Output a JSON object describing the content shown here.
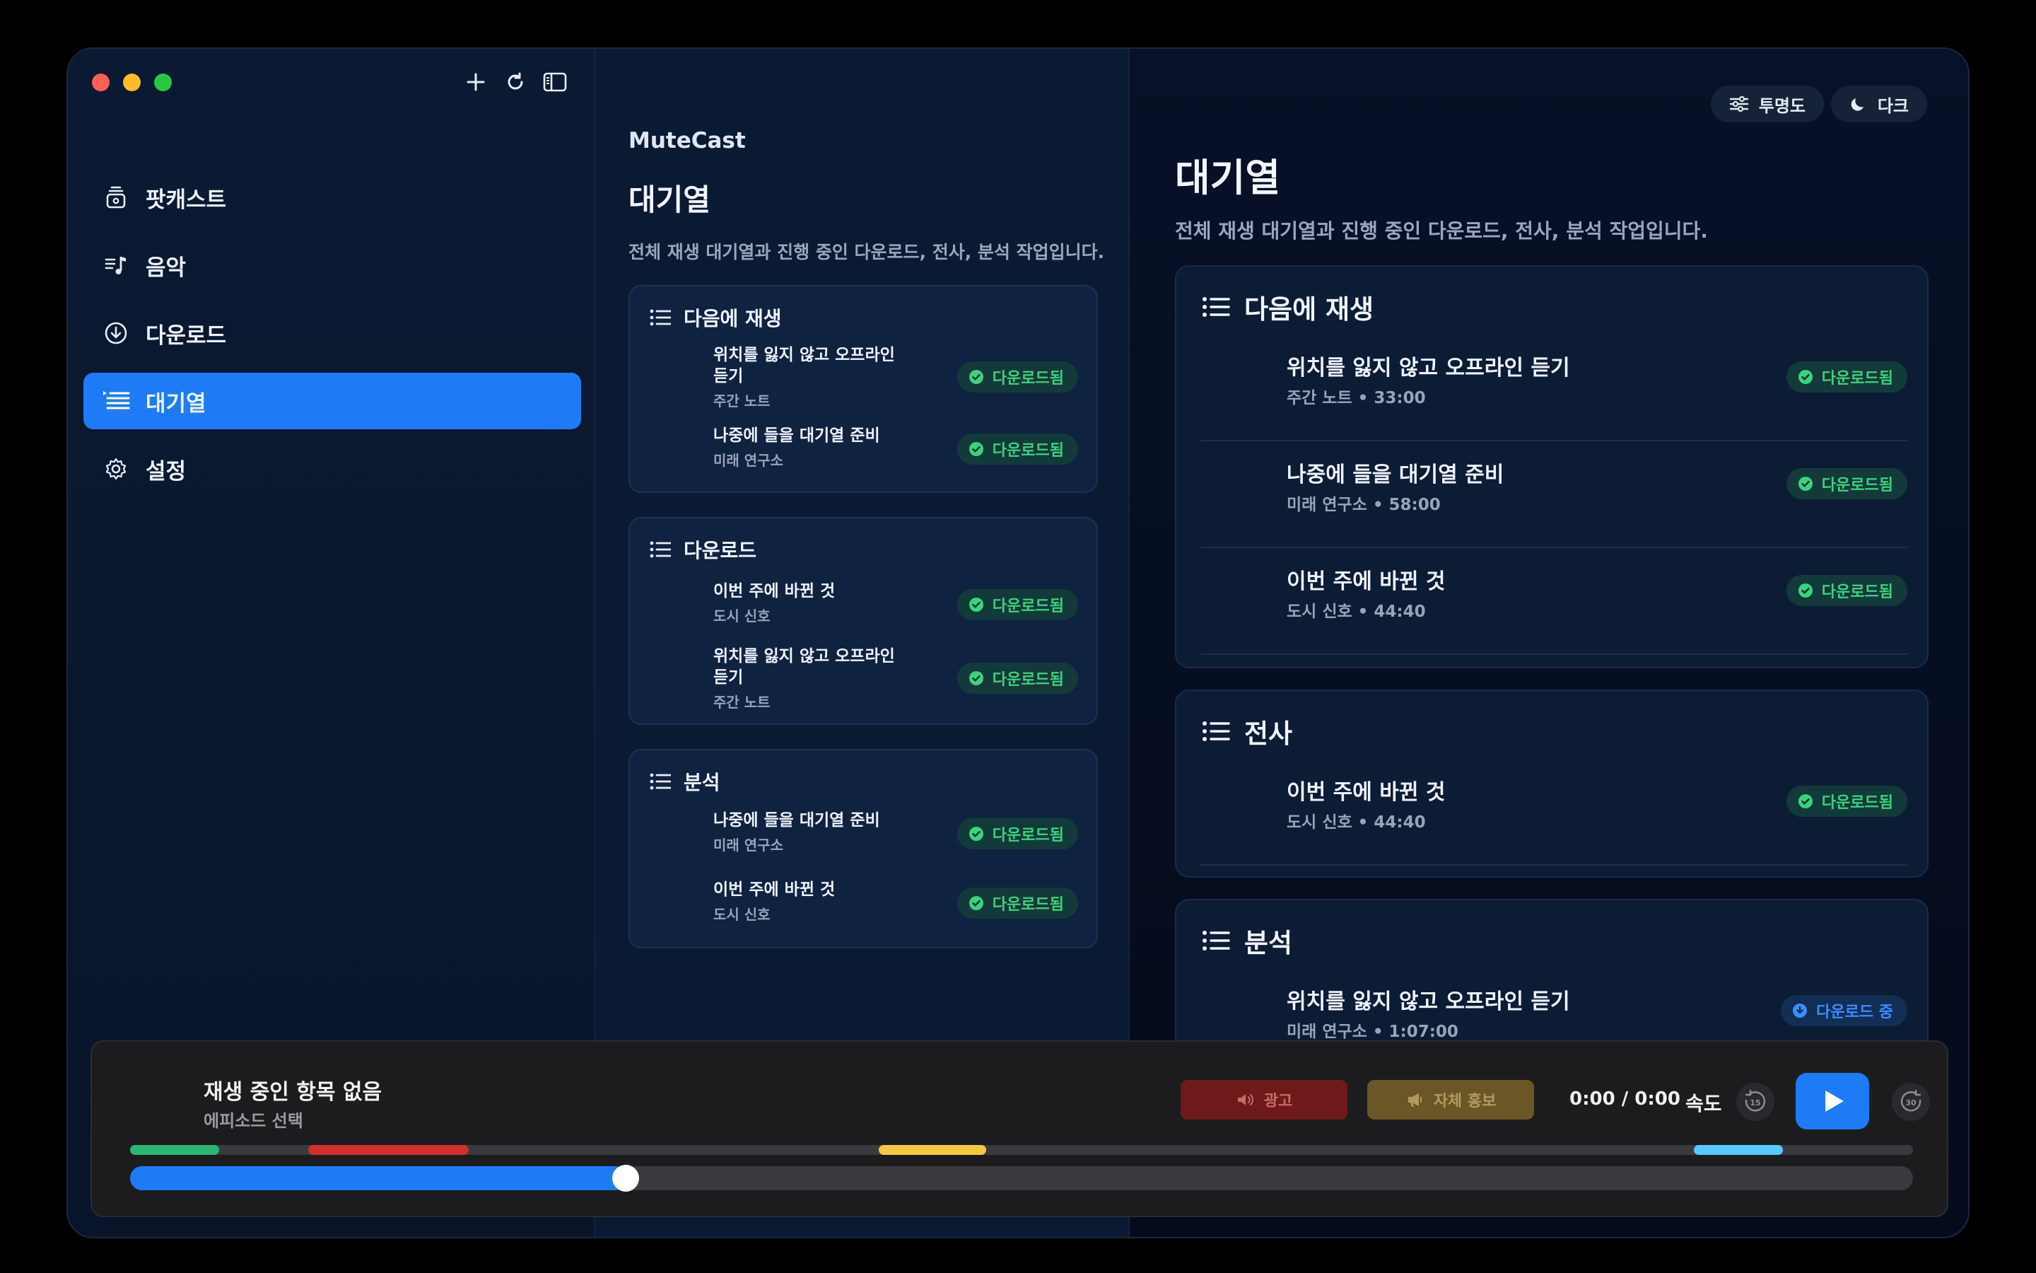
{
  "colors": {
    "accent": "#1e7bf5",
    "downloaded": "#3ed27b",
    "downloading": "#3d8cff"
  },
  "sidebar": {
    "items": [
      {
        "label": "팟캐스트",
        "icon": "podcast-icon"
      },
      {
        "label": "음악",
        "icon": "music-icon"
      },
      {
        "label": "다운로드",
        "icon": "download-icon"
      },
      {
        "label": "대기열",
        "icon": "queue-icon",
        "active": true
      },
      {
        "label": "설정",
        "icon": "gear-icon"
      }
    ]
  },
  "middle": {
    "app_name": "MuteCast",
    "title": "대기열",
    "description": "전체 재생 대기열과 진행 중인 다운로드, 전사, 분석 작업입니다.",
    "sections": [
      {
        "title": "다음에 재생",
        "items": [
          {
            "title": "위치를 잃지 않고 오프라인 듣기",
            "subtitle": "주간 노트",
            "status": "다운로드됨"
          },
          {
            "title": "나중에 들을 대기열 준비",
            "subtitle": "미래 연구소",
            "status": "다운로드됨"
          }
        ]
      },
      {
        "title": "다운로드",
        "items": [
          {
            "title": "이번 주에 바뀐 것",
            "subtitle": "도시 신호",
            "status": "다운로드됨"
          },
          {
            "title": "위치를 잃지 않고 오프라인 듣기",
            "subtitle": "주간 노트",
            "status": "다운로드됨"
          }
        ]
      },
      {
        "title": "분석",
        "items": [
          {
            "title": "나중에 들을 대기열 준비",
            "subtitle": "미래 연구소",
            "status": "다운로드됨"
          },
          {
            "title": "이번 주에 바뀐 것",
            "subtitle": "도시 신호",
            "status": "다운로드됨"
          }
        ]
      }
    ]
  },
  "right": {
    "transparency_label": "투명도",
    "theme_label": "다크",
    "title": "대기열",
    "description": "전체 재생 대기열과 진행 중인 다운로드, 전사, 분석 작업입니다.",
    "sections": [
      {
        "title": "다음에 재생",
        "items": [
          {
            "title": "위치를 잃지 않고 오프라인 듣기",
            "subtitle": "주간 노트 • 33:00",
            "status": "다운로드됨"
          },
          {
            "title": "나중에 들을 대기열 준비",
            "subtitle": "미래 연구소 • 58:00",
            "status": "다운로드됨"
          },
          {
            "title": "이번 주에 바뀐 것",
            "subtitle": "도시 신호 • 44:40",
            "status": "다운로드됨"
          }
        ]
      },
      {
        "title": "전사",
        "items": [
          {
            "title": "이번 주에 바뀐 것",
            "subtitle": "도시 신호 • 44:40",
            "status": "다운로드됨"
          }
        ]
      },
      {
        "title": "분석",
        "items": [
          {
            "title": "위치를 잃지 않고 오프라인 듣기",
            "subtitle": "미래 연구소 • 1:07:00",
            "status": "다운로드 중"
          }
        ]
      }
    ]
  },
  "player": {
    "title": "재생 중인 항목 없음",
    "subtitle": "에피소드 선택",
    "ad_label": "광고",
    "promo_label": "자체 홍보",
    "time": "0:00 / 0:00",
    "speed_label": "속도",
    "skip_back_label": "15",
    "skip_forward_label": "30",
    "progress": 0.278,
    "segments": [
      {
        "type": "intro",
        "color": "#2bb673",
        "start": 0.0,
        "end": 0.05
      },
      {
        "type": "ad",
        "color": "#d0302b",
        "start": 0.1,
        "end": 0.19
      },
      {
        "type": "promo",
        "color": "#f5c842",
        "start": 0.42,
        "end": 0.48
      },
      {
        "type": "outro",
        "color": "#5ac8fa",
        "start": 0.877,
        "end": 0.927
      }
    ]
  }
}
